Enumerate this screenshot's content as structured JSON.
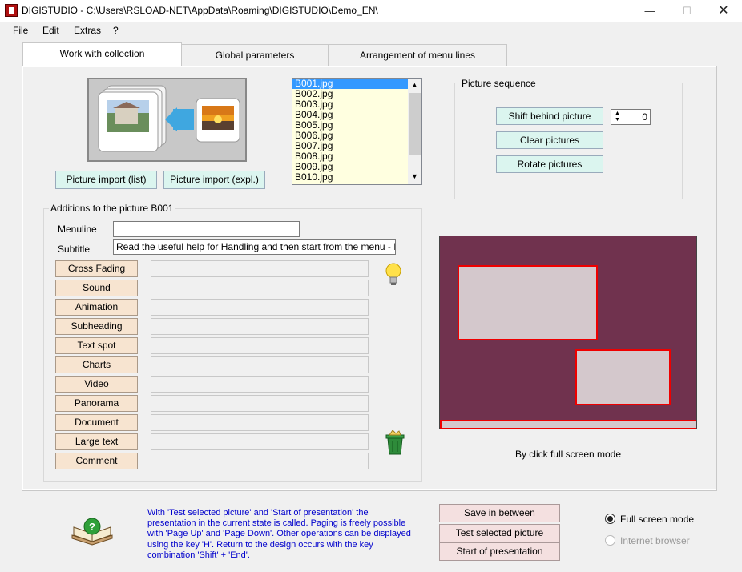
{
  "window": {
    "title": "DIGISTUDIO - C:\\Users\\RSLOAD-NET\\AppData\\Roaming\\DIGISTUDIO\\Demo_EN\\",
    "minimize": "—",
    "maximize": "☐",
    "close": "✕"
  },
  "menu": [
    "File",
    "Edit",
    "Extras",
    "?"
  ],
  "tabs": [
    "Work with collection",
    "Global parameters",
    "Arrangement of menu lines"
  ],
  "import": {
    "list_button": "Picture import (list)",
    "expl_button": "Picture import (expl.)"
  },
  "file_list": {
    "items": [
      "B001.jpg",
      "B002.jpg",
      "B003.jpg",
      "B004.jpg",
      "B005.jpg",
      "B006.jpg",
      "B007.jpg",
      "B008.jpg",
      "B009.jpg",
      "B010.jpg"
    ],
    "selected": "B001.jpg"
  },
  "picture_sequence": {
    "title": "Picture sequence",
    "shift_button": "Shift behind picture",
    "shift_value": "0",
    "clear_button": "Clear pictures",
    "rotate_button": "Rotate pictures"
  },
  "additions": {
    "title": "Additions to the picture B001",
    "menuline_label": "Menuline",
    "menuline_value": "",
    "subtitle_label": "Subtitle",
    "subtitle_value": "Read the useful help for Handling and then start from the menu - Individua",
    "buttons": [
      "Cross Fading",
      "Sound",
      "Animation",
      "Subheading",
      "Text spot",
      "Charts",
      "Video",
      "Panorama",
      "Document",
      "Large text",
      "Comment"
    ]
  },
  "preview": {
    "caption": "By click full screen mode"
  },
  "bottom": {
    "help_text": "With 'Test selected picture' and 'Start of presentation' the presentation in the current state is called. Paging is freely possible with 'Page Up' and 'Page Down'. Other operations can be displayed using the key 'H'. Return to the design occurs with the key combination 'Shift' + 'End'.",
    "save_button": "Save in between",
    "test_button": "Test selected picture",
    "start_button": "Start of presentation",
    "radio_fullscreen": "Full screen mode",
    "radio_browser": "Internet browser",
    "selected_mode": "Full screen mode"
  },
  "colors": {
    "list_bg": "#ffffe0",
    "selection": "#3399ff",
    "preview_bg": "#70324e",
    "frame_border": "#ee0000",
    "help_text": "#0000cc"
  }
}
